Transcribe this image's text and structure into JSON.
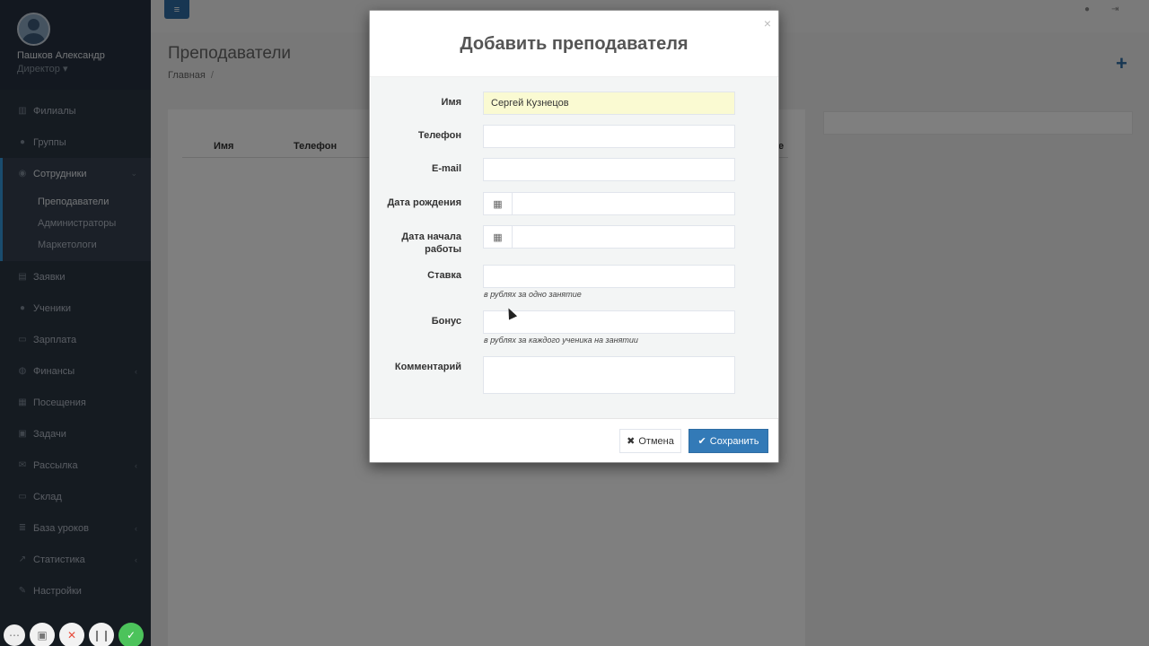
{
  "sidebar": {
    "user_name": "Пашков Александр",
    "user_role": "Директор",
    "items": [
      {
        "label": "Филиалы",
        "icon": "bank-icon"
      },
      {
        "label": "Группы",
        "icon": "users-icon"
      },
      {
        "label": "Сотрудники",
        "icon": "user-circle-icon"
      },
      {
        "label": "Заявки",
        "icon": "clipboard-icon"
      },
      {
        "label": "Ученики",
        "icon": "user-icon"
      },
      {
        "label": "Зарплата",
        "icon": "credit-card-icon"
      },
      {
        "label": "Финансы",
        "icon": "money-icon"
      },
      {
        "label": "Посещения",
        "icon": "calendar-icon"
      },
      {
        "label": "Задачи",
        "icon": "briefcase-icon"
      },
      {
        "label": "Рассылка",
        "icon": "envelope-icon"
      },
      {
        "label": "Склад",
        "icon": "inbox-icon"
      },
      {
        "label": "База уроков",
        "icon": "database-icon"
      },
      {
        "label": "Статистика",
        "icon": "line-chart-icon"
      },
      {
        "label": "Настройки",
        "icon": "wrench-icon"
      }
    ],
    "submenu": [
      "Преподаватели",
      "Администраторы",
      "Маркетологи"
    ]
  },
  "page": {
    "title": "Преподаватели",
    "breadcrumb_home": "Главная",
    "breadcrumb_sep": "/",
    "table_headers": [
      "Имя",
      "Телефон",
      "е"
    ]
  },
  "modal": {
    "title": "Добавить преподавателя",
    "close": "×",
    "fields": {
      "name_label": "Имя",
      "name_value": "Сергей Кузнецов",
      "phone_label": "Телефон",
      "email_label": "E-mail",
      "birth_label": "Дата рождения",
      "start_label_1": "Дата начала",
      "start_label_2": "работы",
      "rate_label": "Ставка",
      "rate_help": "в рублях за одно занятие",
      "bonus_label": "Бонус",
      "bonus_help": "в рублях за каждого ученика на занятии",
      "comment_label": "Комментарий"
    },
    "cancel_label": "Отмена",
    "save_label": "Сохранить"
  }
}
